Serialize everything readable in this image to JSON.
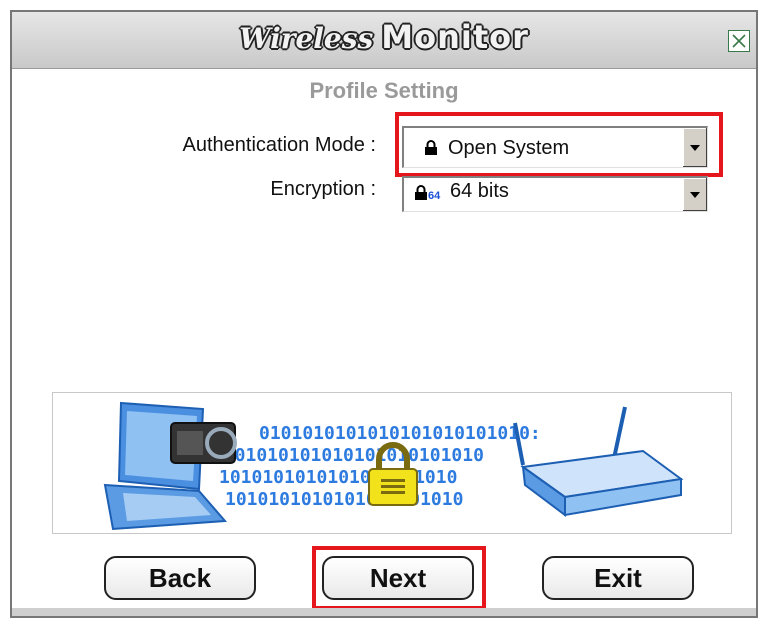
{
  "window": {
    "title_part1": "Wireless",
    "title_part2": "Monitor",
    "close_icon": "close-icon"
  },
  "page": {
    "subtitle": "Profile Setting"
  },
  "form": {
    "auth_label": "Authentication Mode :",
    "auth_value": "Open System",
    "auth_icon": "lock-icon",
    "enc_label": "Encryption :",
    "enc_value": "64 bits",
    "enc_icon": "lock-64-icon",
    "enc_icon_badge": "64"
  },
  "banner": {
    "binary_rows": [
      "0101010101010101010101010:",
      "0101010101010101010101010",
      "1010101010101010101010",
      "1010101010101010101010"
    ],
    "icons": [
      "laptop-icon",
      "padlock-icon",
      "router-icon"
    ]
  },
  "buttons": {
    "back": "Back",
    "next": "Next",
    "exit": "Exit"
  },
  "colors": {
    "highlight": "#e5161c",
    "binary_blue": "#2e7be0",
    "subtitle_gray": "#9a9a9a"
  }
}
